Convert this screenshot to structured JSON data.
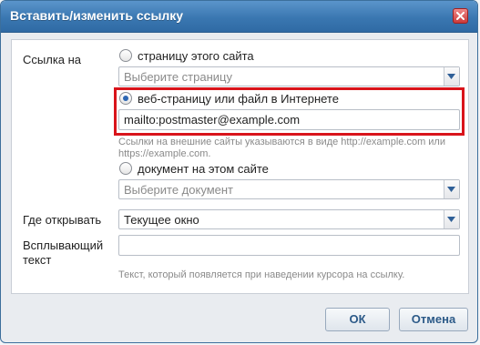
{
  "dialog": {
    "title": "Вставить/изменить ссылку"
  },
  "link_target": {
    "label": "Ссылка на",
    "option_page": "страницу этого сайта",
    "page_select_placeholder": "Выберите страницу",
    "option_web": "веб-страницу или файл в Интернете",
    "web_url_value": "mailto:postmaster@example.com",
    "web_hint": "Ссылки на внешние сайты указываются в виде http://example.com или https://example.com.",
    "option_document": "документ на этом сайте",
    "document_select_placeholder": "Выберите документ",
    "selected": "web"
  },
  "open_in": {
    "label": "Где открывать",
    "value": "Текущее окно"
  },
  "tooltip": {
    "label": "Всплывающий текст",
    "value": "",
    "hint": "Текст, который появляется при наведении курсора на ссылку."
  },
  "buttons": {
    "ok": "ОК",
    "cancel": "Отмена"
  },
  "colors": {
    "titlebar": "#3a77b1",
    "highlight": "#d9141b",
    "button_text": "#2c5a88"
  }
}
